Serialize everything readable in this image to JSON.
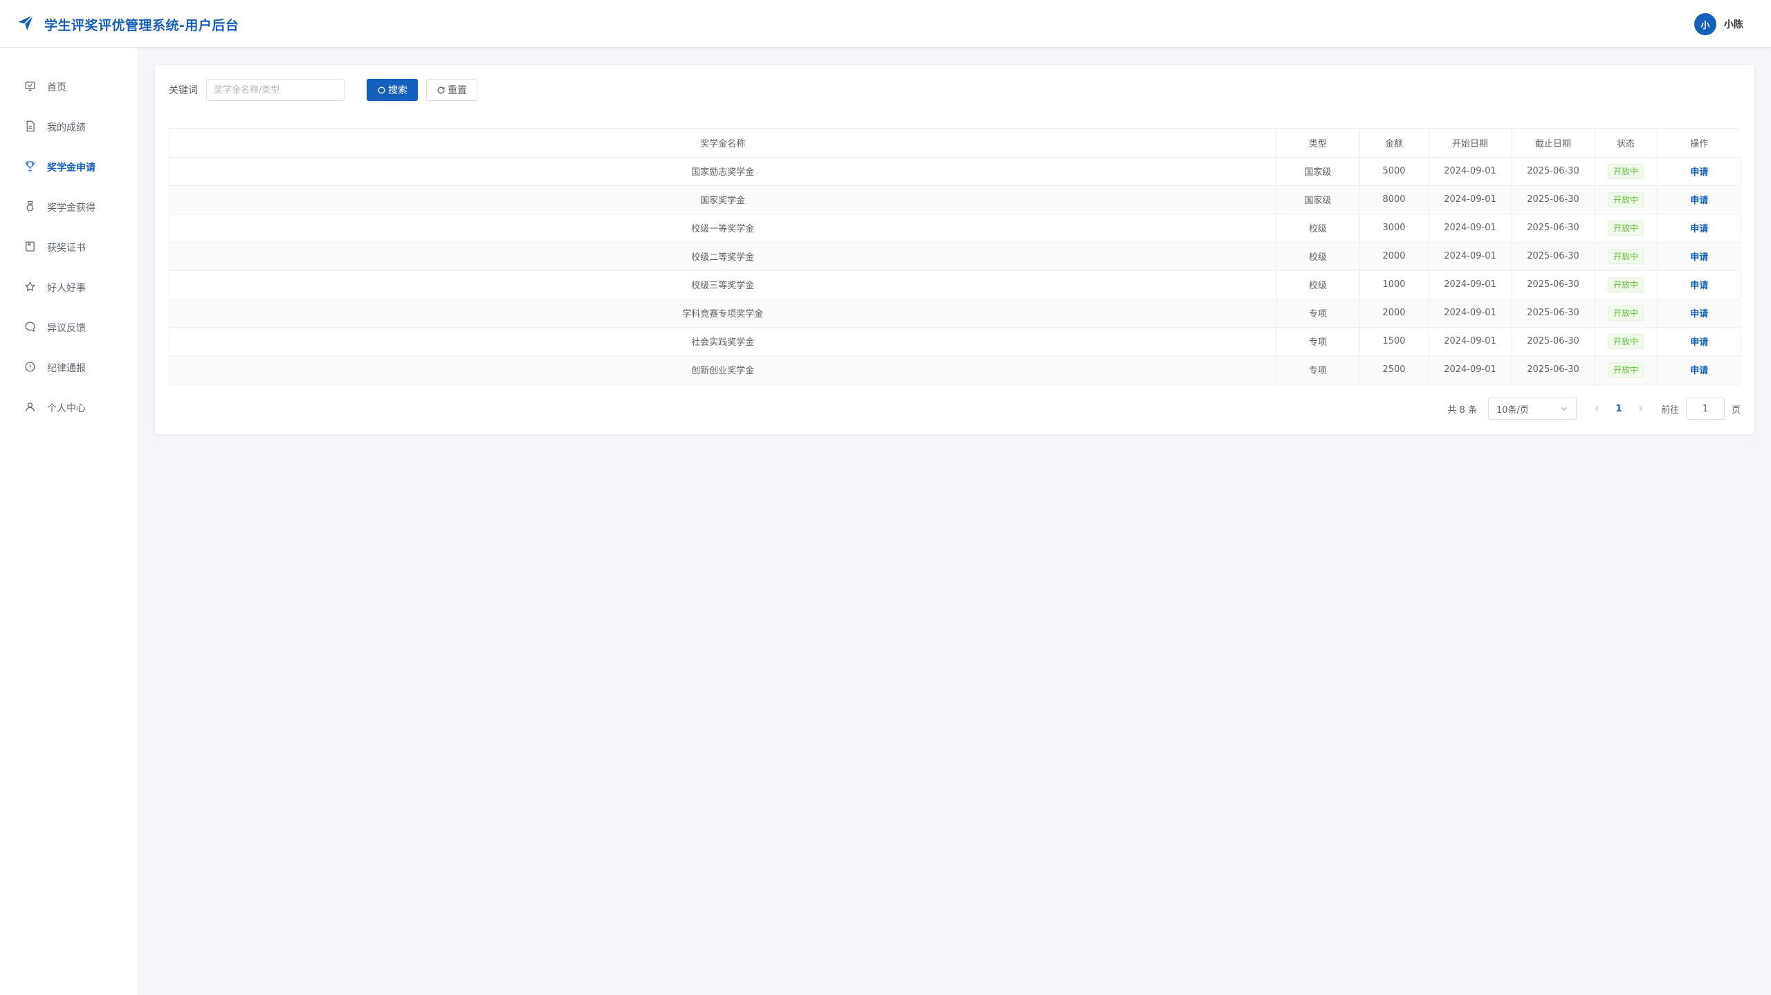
{
  "header": {
    "title": "学生评奖评优管理系统-用户后台",
    "user": {
      "avatar_text": "小",
      "name": "小陈"
    },
    "brand_color": "#1560bd"
  },
  "sidebar": {
    "items": [
      {
        "label": "首页",
        "icon": "home-icon",
        "active": false
      },
      {
        "label": "我的成绩",
        "icon": "document-icon",
        "active": false
      },
      {
        "label": "奖学金申请",
        "icon": "trophy-icon",
        "active": true
      },
      {
        "label": "奖学金获得",
        "icon": "medal-icon",
        "active": false
      },
      {
        "label": "获奖证书",
        "icon": "certificate-icon",
        "active": false
      },
      {
        "label": "好人好事",
        "icon": "star-icon",
        "active": false
      },
      {
        "label": "异议反馈",
        "icon": "chat-icon",
        "active": false
      },
      {
        "label": "纪律通报",
        "icon": "warning-icon",
        "active": false
      },
      {
        "label": "个人中心",
        "icon": "user-icon",
        "active": false
      }
    ]
  },
  "search": {
    "label": "关键词",
    "placeholder": "奖学金名称/类型",
    "value": "",
    "search_button": "搜索",
    "reset_button": "重置"
  },
  "table": {
    "headers": [
      "奖学金名称",
      "类型",
      "金额",
      "开始日期",
      "截止日期",
      "状态",
      "操作"
    ],
    "rows": [
      [
        "国家励志奖学金",
        "国家级",
        "5000",
        "2024-09-01",
        "2025-06-30",
        "开放中",
        "申请"
      ],
      [
        "国家奖学金",
        "国家级",
        "8000",
        "2024-09-01",
        "2025-06-30",
        "开放中",
        "申请"
      ],
      [
        "校级一等奖学金",
        "校级",
        "3000",
        "2024-09-01",
        "2025-06-30",
        "开放中",
        "申请"
      ],
      [
        "校级二等奖学金",
        "校级",
        "2000",
        "2024-09-01",
        "2025-06-30",
        "开放中",
        "申请"
      ],
      [
        "校级三等奖学金",
        "校级",
        "1000",
        "2024-09-01",
        "2025-06-30",
        "开放中",
        "申请"
      ],
      [
        "学科竞赛专项奖学金",
        "专项",
        "2000",
        "2024-09-01",
        "2025-06-30",
        "开放中",
        "申请"
      ],
      [
        "社会实践奖学金",
        "专项",
        "1500",
        "2024-09-01",
        "2025-06-30",
        "开放中",
        "申请"
      ],
      [
        "创新创业奖学金",
        "专项",
        "2500",
        "2024-09-01",
        "2025-06-30",
        "开放中",
        "申请"
      ]
    ]
  },
  "pagination": {
    "total_text": "共 8 条",
    "page_size": "10条/页",
    "current_page": "1",
    "goto_label": "前往",
    "goto_value": "1",
    "goto_suffix": "页"
  }
}
